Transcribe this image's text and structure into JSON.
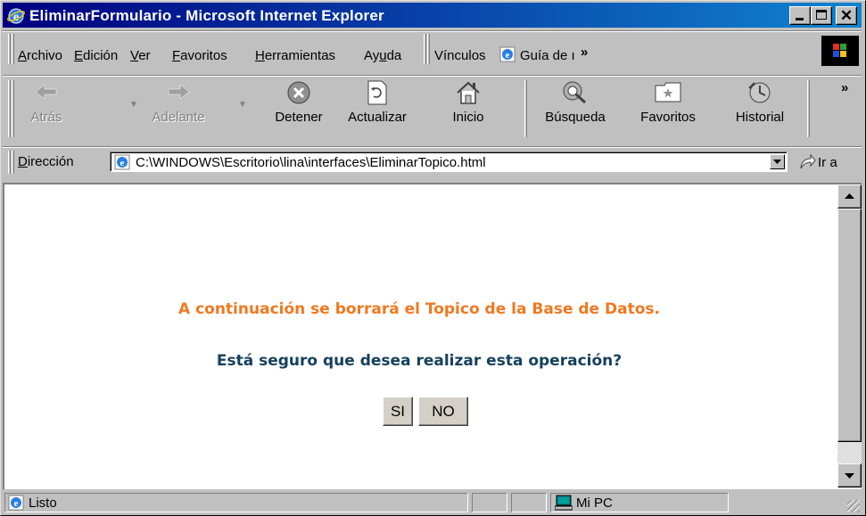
{
  "window": {
    "title": "EliminarFormulario - Microsoft Internet Explorer",
    "controls": {
      "minimize": "_",
      "maximize": "□",
      "close": "×"
    }
  },
  "menu": {
    "items": [
      {
        "label": "Archivo",
        "underline": "A",
        "rest": "rchivo"
      },
      {
        "label": "Edición",
        "underline": "E",
        "rest": "dición"
      },
      {
        "label": "Ver",
        "underline": "V",
        "rest": "er"
      },
      {
        "label": "Favoritos",
        "underline": "F",
        "rest": "avoritos"
      },
      {
        "label": "Herramientas",
        "underline": "H",
        "rest": "erramientas"
      },
      {
        "label": "Ayuda",
        "pre": "Ay",
        "underline": "u",
        "rest": "da"
      }
    ],
    "links_label": "Vínculos",
    "links_item": "Guía de ı",
    "chevron": "»"
  },
  "toolbar": {
    "buttons": [
      {
        "label": "Atrás",
        "icon": "back-arrow-icon",
        "enabled": false
      },
      {
        "label": "Adelante",
        "icon": "forward-arrow-icon",
        "enabled": false
      },
      {
        "label": "Detener",
        "icon": "stop-icon",
        "enabled": true
      },
      {
        "label": "Actualizar",
        "icon": "refresh-icon",
        "enabled": true
      },
      {
        "label": "Inicio",
        "icon": "home-icon",
        "enabled": true
      },
      {
        "label": "Búsqueda",
        "icon": "search-globe-icon",
        "enabled": true
      },
      {
        "label": "Favoritos",
        "icon": "favorites-folder-icon",
        "enabled": true
      },
      {
        "label": "Historial",
        "icon": "history-icon",
        "enabled": true
      }
    ],
    "chevron": "»"
  },
  "address": {
    "label": "Dirección",
    "label_underline": "D",
    "label_rest": "irección",
    "value": "C:\\WINDOWS\\Escritorio\\lina\\interfaces\\EliminarTopico.html",
    "go_label": "Ir a"
  },
  "page": {
    "message_warning": "A continuación se borrará el Topico de la Base de Datos.",
    "message_question": "Está seguro que desea realizar esta operación?",
    "yes_button": "SI",
    "no_button": "NO",
    "colors": {
      "warning": "#f07820",
      "question": "#15405e"
    }
  },
  "status": {
    "text": "Listo",
    "zone": "Mi PC"
  }
}
